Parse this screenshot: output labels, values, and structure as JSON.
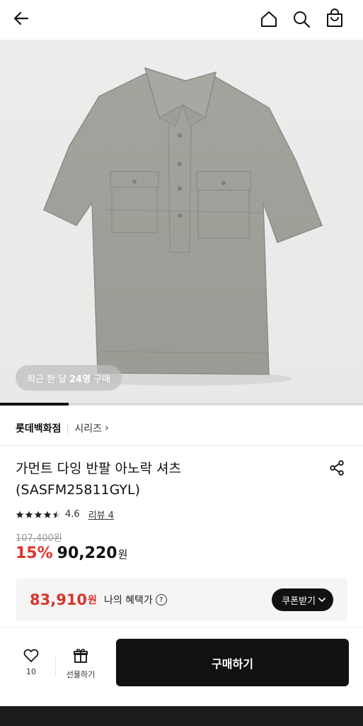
{
  "header": {
    "back_icon": "arrow-left-icon",
    "home_icon": "home-icon",
    "search_icon": "search-icon",
    "cart_icon": "shopping-bag-icon"
  },
  "hero": {
    "recent_prefix": "최근 한 달",
    "recent_count": "24명",
    "recent_suffix": "구매",
    "gallery_progress": 0.19
  },
  "brand": {
    "name": "롯데백화점",
    "series_label": "시리즈",
    "series_chevron": "›"
  },
  "product": {
    "title_line1": "가먼트 다잉 반팔 아노락 셔츠",
    "title_line2": "(SASFM25811GYL)",
    "rating": "4.6",
    "rating_stars": 4.5,
    "review_label": "리뷰 4",
    "original_price": "107,400원",
    "discount_rate": "15%",
    "sale_price": "90,220",
    "currency": "원"
  },
  "benefit": {
    "price": "83,910",
    "currency": "원",
    "label": "나의 혜택가",
    "help": "?",
    "coupon_label": "쿠폰받기"
  },
  "bottom": {
    "like_count": "10",
    "gift_label": "선물하기",
    "buy_label": "구매하기"
  },
  "colors": {
    "accent_red": "#e0332b",
    "button_black": "#111111"
  }
}
